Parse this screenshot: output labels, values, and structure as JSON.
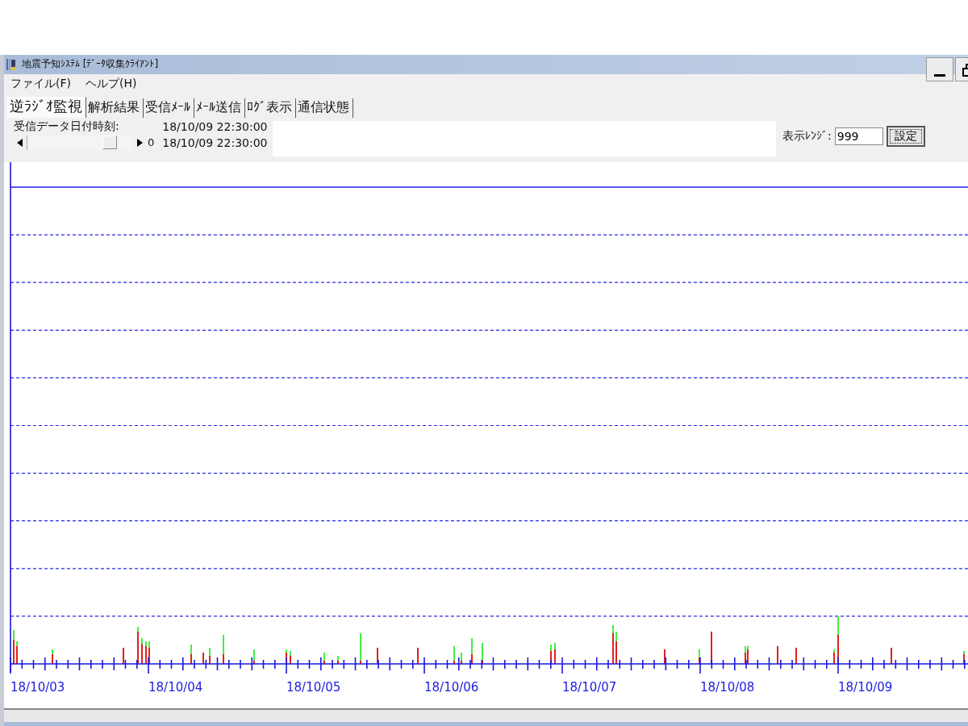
{
  "window": {
    "title": "地震予知ｼｽﾃﾑ [ﾃﾞｰﾀ収集ｸﾗｲｱﾝﾄ]"
  },
  "menu": [
    "ファイル(F)",
    "ヘルプ(H)"
  ],
  "tabs": [
    {
      "label": "逆ﾗｼﾞｵ監視",
      "selected": true
    },
    {
      "label": "解析結果",
      "selected": false
    },
    {
      "label": "受信ﾒｰﾙ",
      "selected": false
    },
    {
      "label": "ﾒｰﾙ送信",
      "selected": false
    },
    {
      "label": "ﾛｸﾞ表示",
      "selected": false
    },
    {
      "label": "通信状態",
      "selected": false
    }
  ],
  "info": {
    "label": "受信データ日付時刻:",
    "received_time": "18/10/09 22:30:00",
    "slider_value": "0",
    "slider_time": "18/10/09 22:30:00"
  },
  "slider": {
    "level": 0.85
  },
  "range": {
    "label": "表示ﾚﾝｼﾞ:",
    "value": "999",
    "button": "設定"
  },
  "chart": {
    "x_labels": [
      "18/10/03",
      "18/10/04",
      "18/10/05",
      "18/10/06",
      "18/10/07",
      "18/10/08",
      "18/10/09"
    ]
  }
}
